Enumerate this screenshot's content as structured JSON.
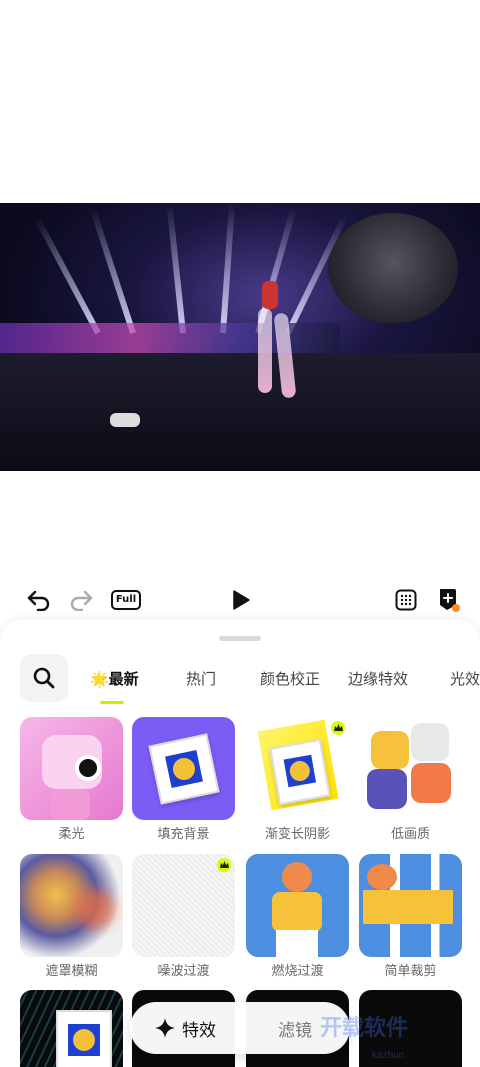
{
  "toolbar": {
    "undo_icon": "undo-icon",
    "redo_icon": "redo-icon",
    "full_label": "Full",
    "play_icon": "play-icon",
    "grid_icon": "grid-icon",
    "add_icon": "add-bookmark-icon"
  },
  "categories": {
    "search_icon": "search-icon",
    "tabs": [
      {
        "label": "🌟最新",
        "active": true
      },
      {
        "label": "热门",
        "active": false
      },
      {
        "label": "颜色校正",
        "active": false
      },
      {
        "label": "边缘特效",
        "active": false
      },
      {
        "label": "光效",
        "active": false
      }
    ],
    "accent_color": "#c7f000"
  },
  "effects": [
    {
      "label": "柔光",
      "premium": false
    },
    {
      "label": "填充背景",
      "premium": false
    },
    {
      "label": "渐变长阴影",
      "premium": true
    },
    {
      "label": "低画质",
      "premium": false
    },
    {
      "label": "遮罩模糊",
      "premium": false
    },
    {
      "label": "噪波过渡",
      "premium": true
    },
    {
      "label": "燃烧过渡",
      "premium": false
    },
    {
      "label": "简单裁剪",
      "premium": false
    }
  ],
  "bottom_bar": {
    "effects_label": "特效",
    "filters_label": "滤镜"
  },
  "watermark": {
    "text": "开载软件",
    "sub": "kazhun"
  }
}
